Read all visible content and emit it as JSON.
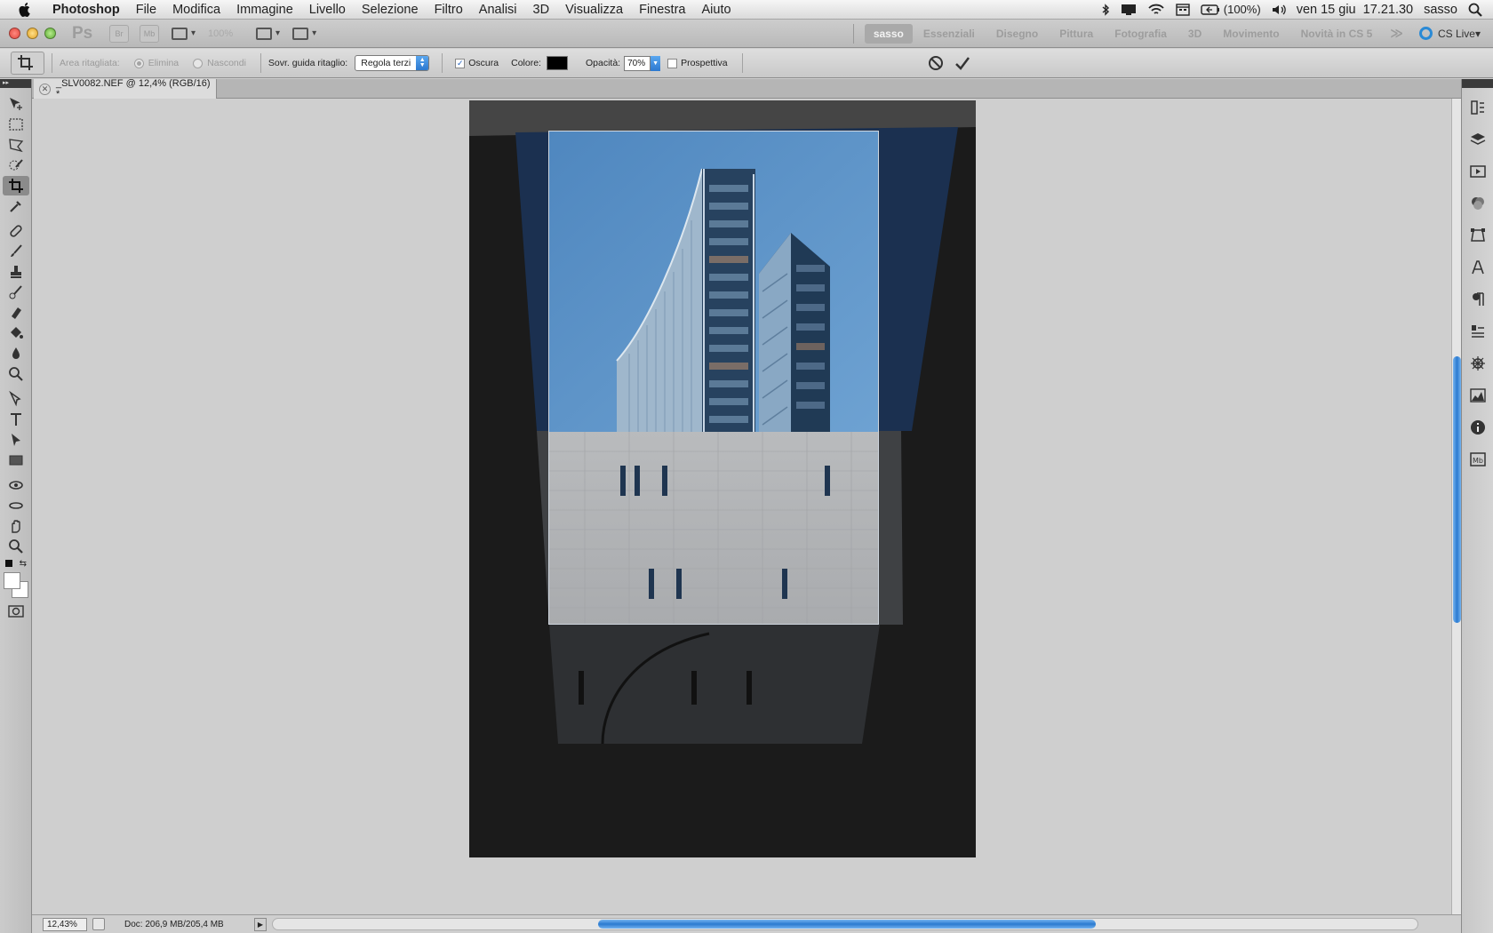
{
  "menubar": {
    "app_name": "Photoshop",
    "items": [
      "File",
      "Modifica",
      "Immagine",
      "Livello",
      "Selezione",
      "Filtro",
      "Analisi",
      "3D",
      "Visualizza",
      "Finestra",
      "Aiuto"
    ],
    "battery": "(100%)",
    "clock": "ven 15 giu  17.21.30",
    "user": "sasso"
  },
  "appbar": {
    "logo": "Ps",
    "bridge_label": "Br",
    "minibridge_label": "Mb",
    "zoom_level": "100%",
    "workspaces": [
      "sasso",
      "Essenziali",
      "Disegno",
      "Pittura",
      "Fotografia",
      "3D",
      "Movimento",
      "Novità in CS 5"
    ],
    "active_workspace": "sasso",
    "more": "≫",
    "cs_live": "CS Live"
  },
  "options": {
    "crop_area_label": "Area ritagliata:",
    "delete_label": "Elimina",
    "hide_label": "Nascondi",
    "overlay_label": "Sovr. guida ritaglio:",
    "overlay_value": "Regola terzi",
    "shield_label": "Oscura",
    "shield_checked": true,
    "color_label": "Colore:",
    "shield_color": "#000000",
    "opacity_label": "Opacità:",
    "opacity_value": "70%",
    "perspective_label": "Prospettiva",
    "perspective_checked": false
  },
  "document": {
    "tab_title": "_SLV0082.NEF @ 12,4% (RGB/16) *"
  },
  "status": {
    "zoom": "12,43%",
    "doc_info": "Doc: 206,9 MB/205,4 MB"
  },
  "colors": {
    "accent_blue": "#2c78cf",
    "sky": "#5f95c8",
    "tower_glass": "#27425f",
    "stone_wall": "#b5b7b9",
    "doc_background": "#1b1b1b"
  }
}
